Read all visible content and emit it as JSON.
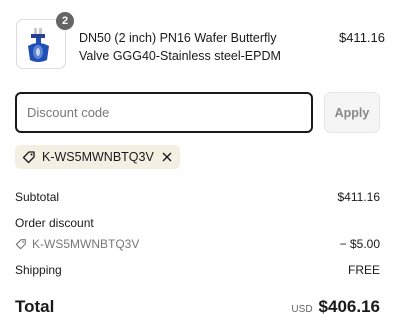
{
  "product": {
    "quantity": "2",
    "name": "DN50 (2 inch) PN16 Wafer Butterfly Valve GGG40-Stainless steel-EPDM",
    "price": "$411.16",
    "thumbnail_icon": "butterfly-valve-image"
  },
  "discount": {
    "placeholder": "Discount code",
    "apply_label": "Apply",
    "applied_code": "K-WS5MWNBTQ3V"
  },
  "summary": {
    "subtotal_label": "Subtotal",
    "subtotal_value": "$411.16",
    "order_discount_label": "Order discount",
    "discount_code": "K-WS5MWNBTQ3V",
    "discount_value": "− $5.00",
    "shipping_label": "Shipping",
    "shipping_value": "FREE",
    "total_label": "Total",
    "currency": "USD",
    "total_value": "$406.16"
  },
  "colors": {
    "chip_background": "#f3efe3",
    "valve_blue": "#1f4fb5",
    "badge": "#666666"
  }
}
